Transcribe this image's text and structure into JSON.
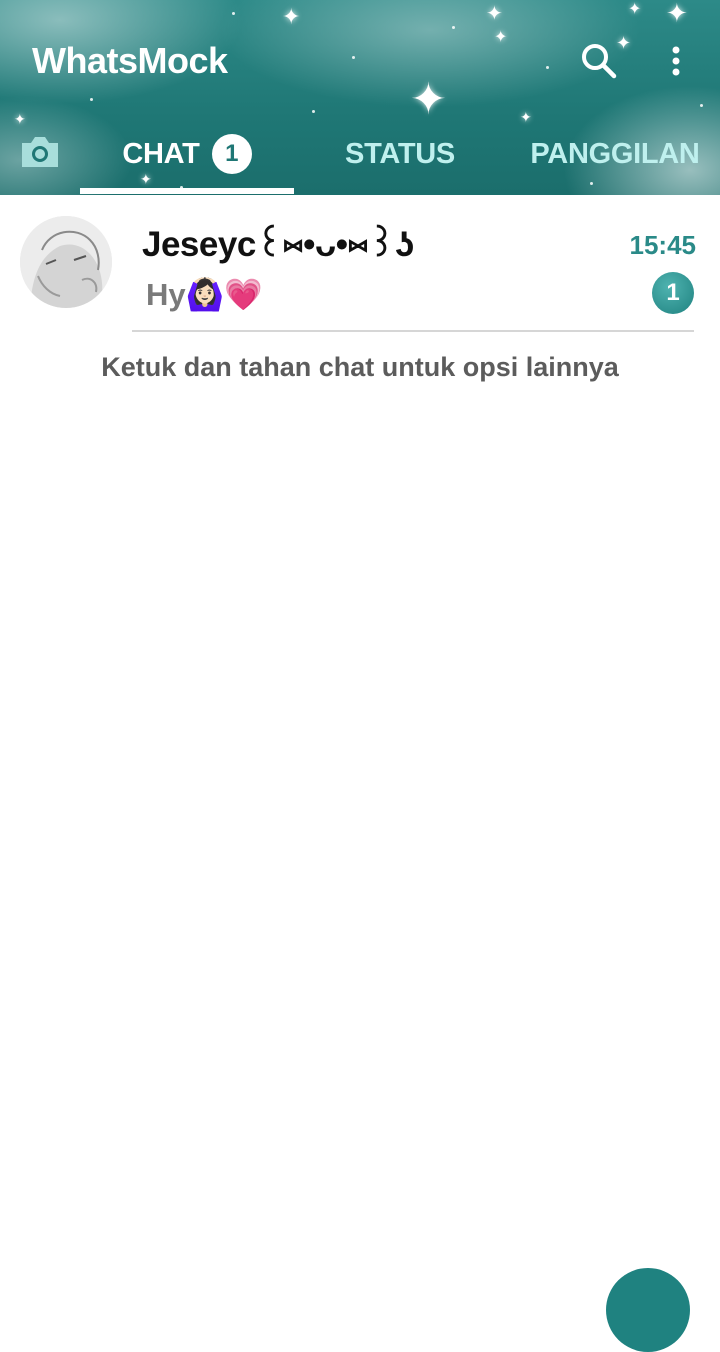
{
  "header": {
    "app_title": "WhatsMock",
    "background_color": "#1f7775"
  },
  "toolbar": {
    "search_icon": "search-icon",
    "menu_icon": "more-vertical-icon"
  },
  "tabs": {
    "camera_icon": "camera-icon",
    "items": [
      {
        "label": "CHAT",
        "badge": "1",
        "active": true
      },
      {
        "label": "STATUS",
        "active": false
      },
      {
        "label": "PANGGILAN",
        "active": false
      }
    ]
  },
  "chats": [
    {
      "name": "Jeseyϲ꒰⑅•ᴗ•⑅꒱ʖ",
      "last_message": "Hy🙆🏻‍♀️💗",
      "time": "15:45",
      "unread": "1"
    }
  ],
  "hint": "Ketuk dan tahan chat untuk opsi lainnya",
  "colors": {
    "accent": "#1f8280",
    "time_text": "#2a8a88",
    "inactive_tab": "#bff0ee"
  }
}
